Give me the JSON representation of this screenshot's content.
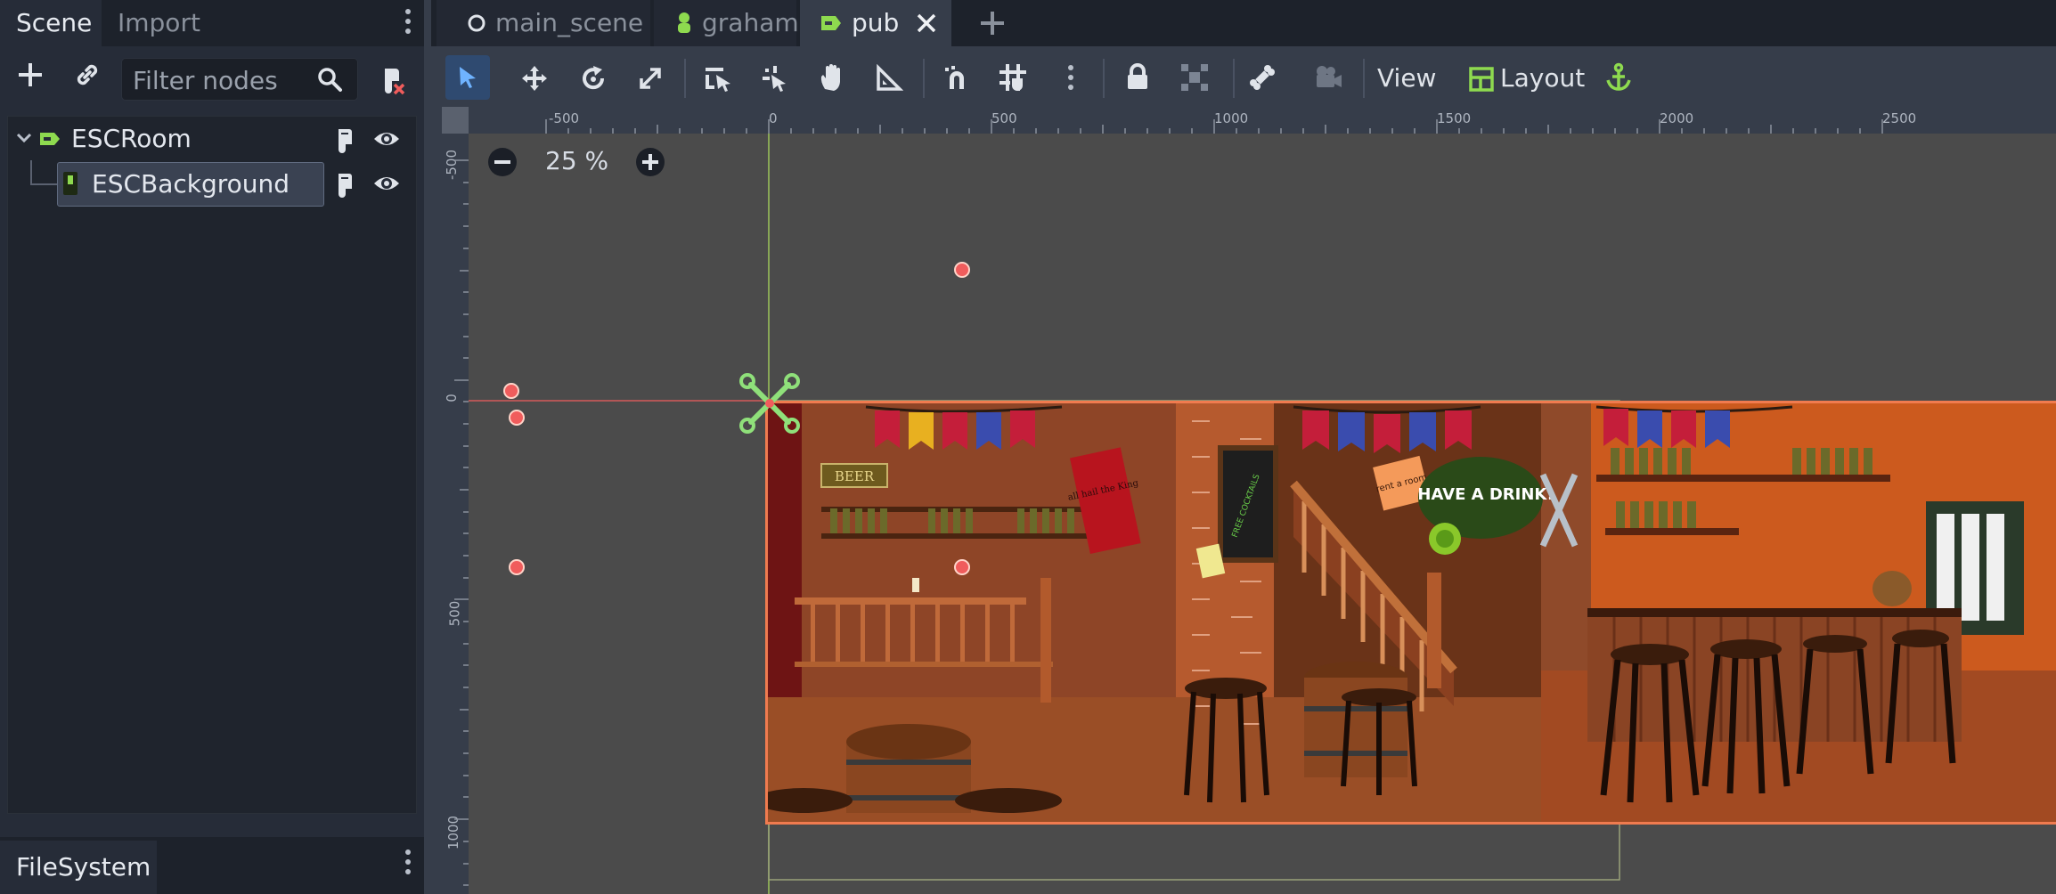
{
  "left_dock": {
    "tabs": [
      "Scene",
      "Import"
    ],
    "filter_placeholder": "Filter nodes",
    "tree": {
      "root": "ESCRoom",
      "child": "ESCBackground"
    },
    "bottom_tab": "FileSystem"
  },
  "scene_tabs": [
    "main_scene",
    "graham",
    "pub"
  ],
  "toolbar": {
    "view_label": "View",
    "layout_label": "Layout"
  },
  "viewport": {
    "zoom": "25 %",
    "ruler_top": [
      "-500",
      "0",
      "500",
      "1000",
      "1500",
      "2000",
      "2500"
    ],
    "ruler_left": [
      "-500",
      "0",
      "500",
      "1000"
    ]
  },
  "pub_scene": {
    "beer_sign": "BEER",
    "poster_text": "all hail the King",
    "chalkboard": "FREE COCKTAILS",
    "room_note": "rent a room",
    "speech_bubble": "HAVE A DRINK!"
  },
  "colors": {
    "accent": "#8eda4f",
    "selection_border": "#f07b4f",
    "panel_bg": "#262c38",
    "editor_bg": "#363d4a",
    "viewport_bg": "#4b4b4b"
  }
}
